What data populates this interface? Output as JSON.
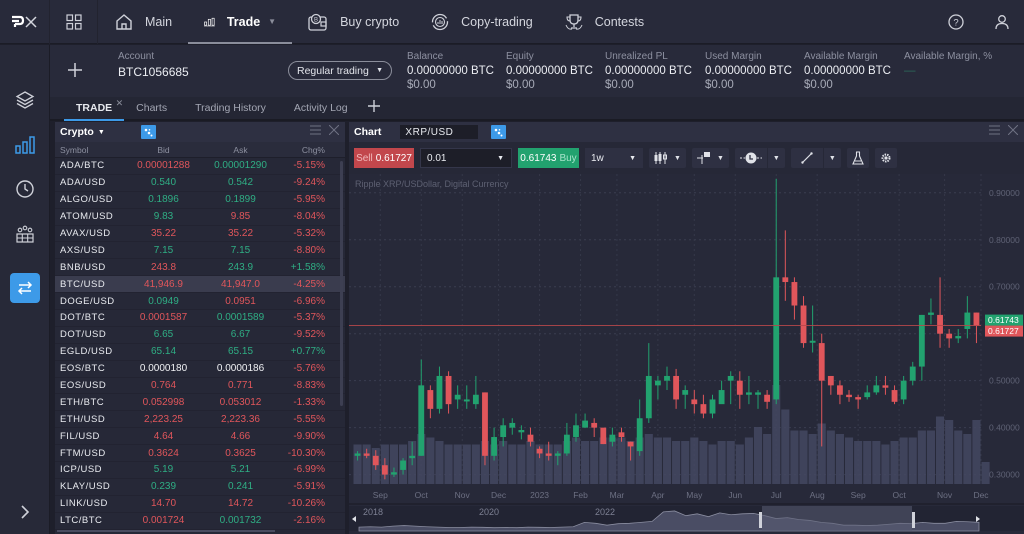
{
  "app": {
    "logo": "PX",
    "nav": [
      {
        "label": "Main",
        "icon": "home-icon"
      },
      {
        "label": "Trade",
        "icon": "bar-chart-icon",
        "active": true
      },
      {
        "label": "Buy crypto",
        "icon": "wallet-bitcoin-icon"
      },
      {
        "label": "Copy-trading",
        "icon": "copy-trading-icon"
      },
      {
        "label": "Contests",
        "icon": "trophy-icon"
      }
    ]
  },
  "sidebar": {
    "items": [
      {
        "icon": "layers-icon"
      },
      {
        "icon": "bar-chart-icon",
        "active": true
      },
      {
        "icon": "clock-icon"
      },
      {
        "icon": "community-icon"
      },
      {
        "icon": "transfer-icon",
        "highlighted": true
      }
    ],
    "expand": "chevron-right-icon"
  },
  "account": {
    "label": "Account",
    "id": "BTC1056685",
    "mode": "Regular trading",
    "metrics": [
      {
        "label": "Balance",
        "btc": "0.00000000 BTC",
        "usd": "$0.00"
      },
      {
        "label": "Equity",
        "btc": "0.00000000 BTC",
        "usd": "$0.00"
      },
      {
        "label": "Unrealized PL",
        "btc": "0.00000000 BTC",
        "usd": "$0.00"
      },
      {
        "label": "Used Margin",
        "btc": "0.00000000 BTC",
        "usd": "$0.00"
      },
      {
        "label": "Available Margin",
        "btc": "0.00000000 BTC",
        "usd": "$0.00"
      },
      {
        "label": "Available Margin, %",
        "btc": "—",
        "usd": ""
      }
    ]
  },
  "tabs": [
    {
      "label": "TRADE",
      "active": true,
      "closable": true
    },
    {
      "label": "Charts"
    },
    {
      "label": "Trading History"
    },
    {
      "label": "Activity Log"
    }
  ],
  "watchlist": {
    "title": "Crypto",
    "columns": [
      "Symbol",
      "Bid",
      "Ask",
      "Chg%"
    ],
    "rows": [
      {
        "symbol": "ADA/BTC",
        "bid": "0.00001288",
        "ask": "0.00001290",
        "chg": "-5.15%",
        "bid_dir": "dn",
        "ask_dir": "up"
      },
      {
        "symbol": "ADA/USD",
        "bid": "0.540",
        "ask": "0.542",
        "chg": "-9.24%",
        "bid_dir": "up",
        "ask_dir": "up"
      },
      {
        "symbol": "ALGO/USD",
        "bid": "0.1896",
        "ask": "0.1899",
        "chg": "-5.95%",
        "bid_dir": "up",
        "ask_dir": "up"
      },
      {
        "symbol": "ATOM/USD",
        "bid": "9.83",
        "ask": "9.85",
        "chg": "-8.04%",
        "bid_dir": "up",
        "ask_dir": "dn"
      },
      {
        "symbol": "AVAX/USD",
        "bid": "35.22",
        "ask": "35.22",
        "chg": "-5.32%",
        "bid_dir": "dn",
        "ask_dir": "dn"
      },
      {
        "symbol": "AXS/USD",
        "bid": "7.15",
        "ask": "7.15",
        "chg": "-8.80%",
        "bid_dir": "up",
        "ask_dir": "up"
      },
      {
        "symbol": "BNB/USD",
        "bid": "243.8",
        "ask": "243.9",
        "chg": "+1.58%",
        "bid_dir": "dn",
        "ask_dir": "up"
      },
      {
        "symbol": "BTC/USD",
        "bid": "41,946.9",
        "ask": "41,947.0",
        "chg": "-4.25%",
        "bid_dir": "dn",
        "ask_dir": "dn",
        "selected": true
      },
      {
        "symbol": "DOGE/USD",
        "bid": "0.0949",
        "ask": "0.0951",
        "chg": "-6.96%",
        "bid_dir": "up",
        "ask_dir": "dn"
      },
      {
        "symbol": "DOT/BTC",
        "bid": "0.0001587",
        "ask": "0.0001589",
        "chg": "-5.37%",
        "bid_dir": "dn",
        "ask_dir": "up"
      },
      {
        "symbol": "DOT/USD",
        "bid": "6.65",
        "ask": "6.67",
        "chg": "-9.52%",
        "bid_dir": "up",
        "ask_dir": "up"
      },
      {
        "symbol": "EGLD/USD",
        "bid": "65.14",
        "ask": "65.15",
        "chg": "+0.77%",
        "bid_dir": "up",
        "ask_dir": "up"
      },
      {
        "symbol": "EOS/BTC",
        "bid": "0.0000180",
        "ask": "0.0000186",
        "chg": "-5.76%",
        "bid_dir": "neu",
        "ask_dir": "neu"
      },
      {
        "symbol": "EOS/USD",
        "bid": "0.764",
        "ask": "0.771",
        "chg": "-8.83%",
        "bid_dir": "dn",
        "ask_dir": "dn"
      },
      {
        "symbol": "ETH/BTC",
        "bid": "0.052998",
        "ask": "0.053012",
        "chg": "-1.33%",
        "bid_dir": "dn",
        "ask_dir": "dn"
      },
      {
        "symbol": "ETH/USD",
        "bid": "2,223.25",
        "ask": "2,223.36",
        "chg": "-5.55%",
        "bid_dir": "dn",
        "ask_dir": "dn"
      },
      {
        "symbol": "FIL/USD",
        "bid": "4.64",
        "ask": "4.66",
        "chg": "-9.90%",
        "bid_dir": "dn",
        "ask_dir": "dn"
      },
      {
        "symbol": "FTM/USD",
        "bid": "0.3624",
        "ask": "0.3625",
        "chg": "-10.30%",
        "bid_dir": "dn",
        "ask_dir": "dn"
      },
      {
        "symbol": "ICP/USD",
        "bid": "5.19",
        "ask": "5.21",
        "chg": "-6.99%",
        "bid_dir": "up",
        "ask_dir": "up"
      },
      {
        "symbol": "KLAY/USD",
        "bid": "0.239",
        "ask": "0.241",
        "chg": "-5.91%",
        "bid_dir": "up",
        "ask_dir": "up"
      },
      {
        "symbol": "LINK/USD",
        "bid": "14.70",
        "ask": "14.72",
        "chg": "-10.26%",
        "bid_dir": "dn",
        "ask_dir": "dn"
      },
      {
        "symbol": "LTC/BTC",
        "bid": "0.001724",
        "ask": "0.001732",
        "chg": "-2.16%",
        "bid_dir": "dn",
        "ask_dir": "up"
      }
    ]
  },
  "chart": {
    "title": "Chart",
    "symbol": "XRP/USD",
    "sell_label": "Sell",
    "sell_price": "0.61727",
    "buy_label": "Buy",
    "buy_price": "0.61743",
    "quantity": "0.01",
    "timeframe": "1w",
    "subtitle": "Ripple XRP/USDollar, Digital Currency",
    "colors": {
      "up": "#22a26f",
      "down": "#e0565b",
      "volume": "#444862"
    }
  },
  "chart_data": {
    "type": "candlestick",
    "title": "Ripple XRP/USDollar, Digital Currency",
    "timeframe": "1w",
    "y_ticks": [
      "0.90000",
      "0.80000",
      "0.70000",
      "0.60000",
      "0.50000",
      "0.40000",
      "0.30000"
    ],
    "ylim": [
      0.28,
      0.94
    ],
    "x_ticks": [
      "Sep",
      "Oct",
      "Nov",
      "Dec",
      "2023",
      "Feb",
      "Mar",
      "Apr",
      "May",
      "Jun",
      "Jul",
      "Aug",
      "Sep",
      "Oct",
      "Nov",
      "Dec"
    ],
    "current_ask": 0.61743,
    "current_bid": 0.61727,
    "candles": [
      [
        0.34,
        0.345,
        0.33,
        0.35
      ],
      [
        0.345,
        0.34,
        0.335,
        0.355
      ],
      [
        0.34,
        0.32,
        0.31,
        0.352
      ],
      [
        0.32,
        0.3,
        0.29,
        0.335
      ],
      [
        0.3,
        0.305,
        0.295,
        0.315
      ],
      [
        0.31,
        0.33,
        0.3,
        0.335
      ],
      [
        0.335,
        0.34,
        0.32,
        0.37
      ],
      [
        0.34,
        0.49,
        0.34,
        0.545
      ],
      [
        0.48,
        0.44,
        0.42,
        0.49
      ],
      [
        0.44,
        0.51,
        0.43,
        0.53
      ],
      [
        0.51,
        0.45,
        0.43,
        0.52
      ],
      [
        0.46,
        0.47,
        0.44,
        0.49
      ],
      [
        0.46,
        0.46,
        0.44,
        0.49
      ],
      [
        0.45,
        0.47,
        0.44,
        0.51
      ],
      [
        0.475,
        0.34,
        0.32,
        0.475
      ],
      [
        0.34,
        0.38,
        0.33,
        0.4
      ],
      [
        0.38,
        0.405,
        0.36,
        0.42
      ],
      [
        0.4,
        0.41,
        0.385,
        0.42
      ],
      [
        0.39,
        0.395,
        0.375,
        0.405
      ],
      [
        0.385,
        0.37,
        0.36,
        0.4
      ],
      [
        0.355,
        0.345,
        0.335,
        0.36
      ],
      [
        0.345,
        0.34,
        0.33,
        0.37
      ],
      [
        0.34,
        0.345,
        0.32,
        0.35
      ],
      [
        0.345,
        0.385,
        0.34,
        0.41
      ],
      [
        0.38,
        0.405,
        0.37,
        0.43
      ],
      [
        0.4,
        0.415,
        0.4,
        0.43
      ],
      [
        0.41,
        0.4,
        0.38,
        0.42
      ],
      [
        0.4,
        0.365,
        0.365,
        0.39
      ],
      [
        0.37,
        0.385,
        0.36,
        0.4
      ],
      [
        0.39,
        0.38,
        0.37,
        0.4
      ],
      [
        0.37,
        0.36,
        0.33,
        0.37
      ],
      [
        0.35,
        0.42,
        0.34,
        0.46
      ],
      [
        0.42,
        0.51,
        0.41,
        0.58
      ],
      [
        0.49,
        0.5,
        0.46,
        0.51
      ],
      [
        0.5,
        0.51,
        0.48,
        0.53
      ],
      [
        0.51,
        0.46,
        0.44,
        0.525
      ],
      [
        0.47,
        0.48,
        0.44,
        0.49
      ],
      [
        0.46,
        0.45,
        0.43,
        0.48
      ],
      [
        0.45,
        0.43,
        0.42,
        0.47
      ],
      [
        0.43,
        0.46,
        0.42,
        0.47
      ],
      [
        0.45,
        0.48,
        0.46,
        0.5
      ],
      [
        0.5,
        0.51,
        0.45,
        0.52
      ],
      [
        0.5,
        0.47,
        0.44,
        0.52
      ],
      [
        0.47,
        0.475,
        0.45,
        0.51
      ],
      [
        0.47,
        0.475,
        0.44,
        0.48
      ],
      [
        0.47,
        0.455,
        0.44,
        0.48
      ],
      [
        0.46,
        0.72,
        0.45,
        0.93
      ],
      [
        0.72,
        0.71,
        0.67,
        0.82
      ],
      [
        0.71,
        0.66,
        0.63,
        0.72
      ],
      [
        0.66,
        0.58,
        0.57,
        0.68
      ],
      [
        0.585,
        0.585,
        0.56,
        0.66
      ],
      [
        0.58,
        0.5,
        0.36,
        0.6
      ],
      [
        0.51,
        0.49,
        0.47,
        0.51
      ],
      [
        0.49,
        0.47,
        0.45,
        0.5
      ],
      [
        0.47,
        0.465,
        0.455,
        0.48
      ],
      [
        0.465,
        0.46,
        0.44,
        0.47
      ],
      [
        0.465,
        0.475,
        0.46,
        0.49
      ],
      [
        0.475,
        0.49,
        0.47,
        0.51
      ],
      [
        0.49,
        0.485,
        0.47,
        0.51
      ],
      [
        0.48,
        0.455,
        0.45,
        0.49
      ],
      [
        0.46,
        0.5,
        0.45,
        0.51
      ],
      [
        0.5,
        0.53,
        0.49,
        0.54
      ],
      [
        0.53,
        0.64,
        0.5,
        0.64
      ],
      [
        0.64,
        0.645,
        0.62,
        0.675
      ],
      [
        0.64,
        0.6,
        0.57,
        0.72
      ],
      [
        0.6,
        0.59,
        0.57,
        0.61
      ],
      [
        0.59,
        0.595,
        0.58,
        0.61
      ],
      [
        0.61,
        0.645,
        0.59,
        0.68
      ],
      [
        0.645,
        0.617,
        0.58,
        0.645
      ]
    ],
    "volume_relative": [
      0.55,
      0.55,
      0.54,
      0.55,
      0.55,
      0.55,
      0.56,
      0.58,
      0.57,
      0.56,
      0.55,
      0.55,
      0.55,
      0.55,
      0.56,
      0.55,
      0.56,
      0.55,
      0.55,
      0.56,
      0.55,
      0.55,
      0.55,
      0.56,
      0.57,
      0.56,
      0.56,
      0.57,
      0.57,
      0.57,
      0.56,
      0.57,
      0.58,
      0.57,
      0.57,
      0.56,
      0.56,
      0.57,
      0.56,
      0.55,
      0.56,
      0.56,
      0.55,
      0.57,
      0.6,
      0.58,
      0.72,
      0.65,
      0.59,
      0.59,
      0.58,
      0.61,
      0.59,
      0.58,
      0.57,
      0.56,
      0.56,
      0.56,
      0.55,
      0.56,
      0.57,
      0.57,
      0.59,
      0.59,
      0.63,
      0.62,
      0.59,
      0.58,
      0.62,
      0.5
    ],
    "navigator": {
      "labels": [
        "2018",
        "2020",
        "2022"
      ]
    }
  }
}
